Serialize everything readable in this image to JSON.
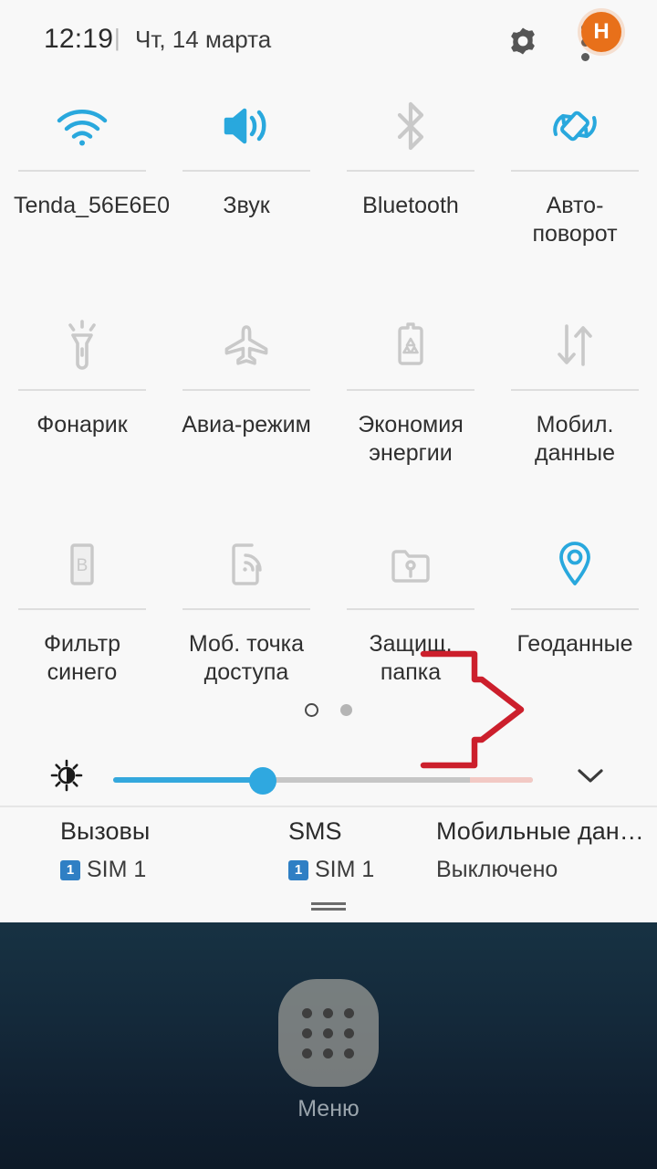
{
  "statusbar": {
    "time": "12:19",
    "separator": "|",
    "date": "Чт, 14 марта",
    "gear_icon": "gear-icon",
    "menu_icon": "three-dot-menu-icon",
    "avatar_initial": "H",
    "avatar_color": "#e8701a"
  },
  "colors": {
    "active": "#29a8dd",
    "inactive": "#c9c9c9",
    "panel_bg": "#f8f8f8",
    "annotation": "#cc1f2c",
    "sim_badge": "#2f7fc4"
  },
  "tiles": [
    {
      "icon": "wifi-icon",
      "label": "Tenda_56E6E0",
      "state": "on"
    },
    {
      "icon": "volume-icon",
      "label": "Звук",
      "state": "on"
    },
    {
      "icon": "bluetooth-icon",
      "label": "Bluetooth",
      "state": "off"
    },
    {
      "icon": "auto-rotate-icon",
      "label": "Авто-поворот",
      "state": "on"
    },
    {
      "icon": "flashlight-icon",
      "label": "Фонарик",
      "state": "off"
    },
    {
      "icon": "airplane-icon",
      "label": "Авиа-режим",
      "state": "off"
    },
    {
      "icon": "battery-saver-icon",
      "label": "Экономия энергии",
      "state": "off"
    },
    {
      "icon": "mobile-data-icon",
      "label": "Мобил. данные",
      "state": "off"
    },
    {
      "icon": "blue-filter-icon",
      "label": "Фильтр синего",
      "state": "off"
    },
    {
      "icon": "hotspot-icon",
      "label": "Моб. точка доступа",
      "state": "off"
    },
    {
      "icon": "secure-folder-icon",
      "label": "Защищ. папка",
      "state": "off"
    },
    {
      "icon": "location-icon",
      "label": "Геоданные",
      "state": "on"
    }
  ],
  "pager": {
    "pages": 2,
    "current": 1
  },
  "brightness": {
    "icon": "brightness-icon",
    "value_percent": 36,
    "expand_icon": "chevron-down-icon"
  },
  "sim_strip": [
    {
      "title": "Вызовы",
      "badge": "1",
      "value": "SIM 1"
    },
    {
      "title": "SMS",
      "badge": "1",
      "value": "SIM 1"
    },
    {
      "title": "Мобильные дан…",
      "badge": "",
      "value": "Выключено"
    }
  ],
  "handle_icon": "drag-handle-icon",
  "annotation": {
    "icon": "red-arrow-right-annotation"
  },
  "home": {
    "app_drawer_icon": "app-grid-icon",
    "app_drawer_label": "Меню"
  }
}
